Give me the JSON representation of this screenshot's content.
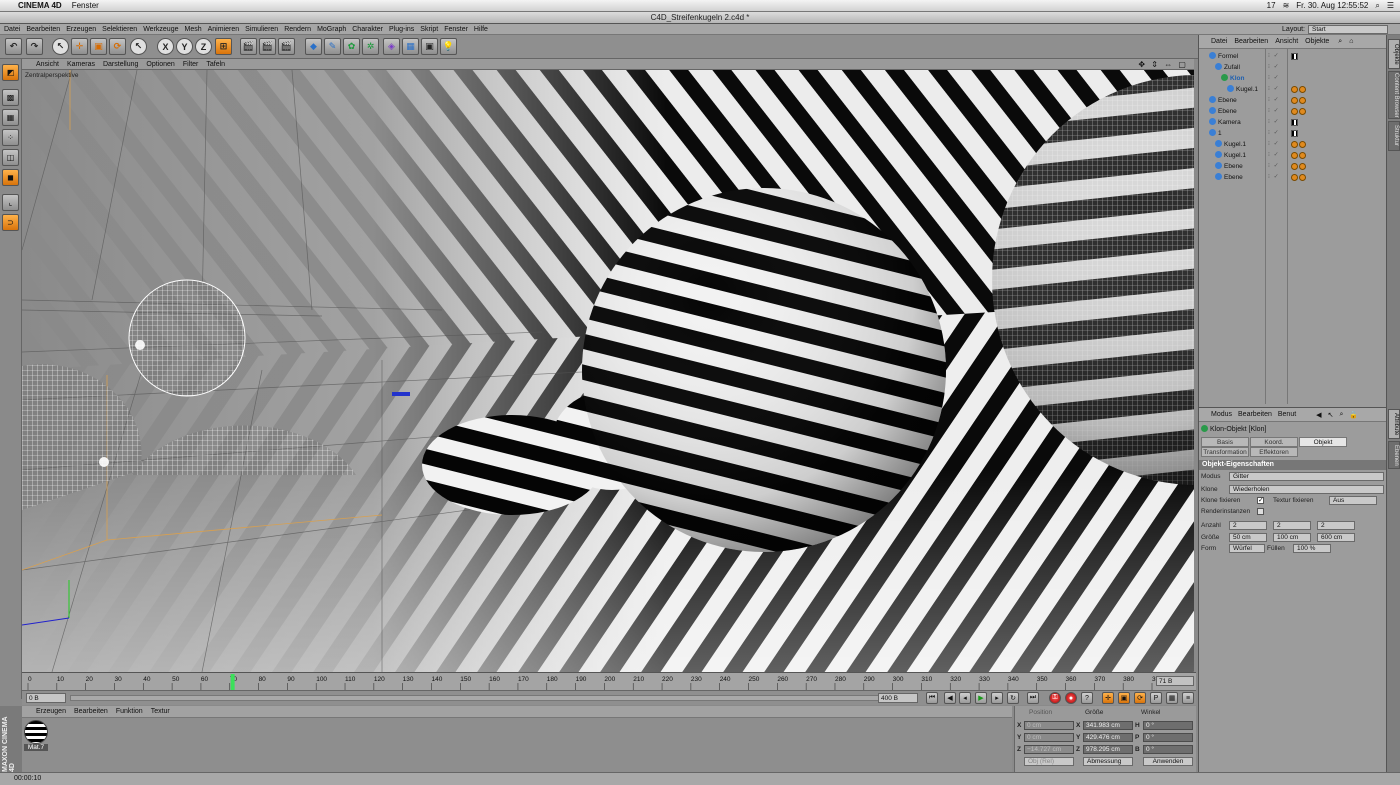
{
  "os": {
    "app": "CINEMA 4D",
    "menu": "Fenster",
    "status": [
      "17",
      "Fr. 30. Aug  12:55:52"
    ]
  },
  "window_title": "C4D_Streifenkugeln 2.c4d *",
  "menubar": {
    "items": [
      "Datei",
      "Bearbeiten",
      "Erzeugen",
      "Selektieren",
      "Werkzeuge",
      "Mesh",
      "Animieren",
      "Simulieren",
      "Rendern",
      "MoGraph",
      "Charakter",
      "Plug-ins",
      "Skript",
      "Fenster",
      "Hilfe"
    ],
    "layout_label": "Layout:",
    "layout_value": "Start"
  },
  "toolbar": {
    "axis_buttons": [
      "X",
      "Y",
      "Z"
    ]
  },
  "viewport": {
    "menu": [
      "Ansicht",
      "Kameras",
      "Darstellung",
      "Optionen",
      "Filter",
      "Tafeln"
    ],
    "label": "Zentralperspektive",
    "nav_icons": "✥ ⇕ ⇔ ▢"
  },
  "timeline": {
    "ticks": [
      "0",
      "10",
      "20",
      "30",
      "40",
      "50",
      "60",
      "70",
      "80",
      "90",
      "100",
      "110",
      "120",
      "130",
      "140",
      "150",
      "160",
      "170",
      "180",
      "190",
      "200",
      "210",
      "220",
      "230",
      "240",
      "250",
      "260",
      "270",
      "280",
      "290",
      "300",
      "310",
      "320",
      "330",
      "340",
      "350",
      "360",
      "370",
      "380",
      "390"
    ],
    "current": 71,
    "max": 390,
    "end_field": "71 B",
    "start_field": "0 B",
    "max_field": "400 B"
  },
  "materials": {
    "menu": [
      "Erzeugen",
      "Bearbeiten",
      "Funktion",
      "Textur"
    ],
    "items": [
      "Mat.7"
    ],
    "logo": "MAXON CINEMA 4D"
  },
  "coords": {
    "headers": [
      "Position",
      "Größe",
      "Winkel"
    ],
    "rows": [
      {
        "axis": "X",
        "pos": "0 cm",
        "size": "341.983 cm",
        "rot_axis": "H",
        "rot": "0 °"
      },
      {
        "axis": "Y",
        "pos": "0 cm",
        "size": "429.476 cm",
        "rot_axis": "P",
        "rot": "0 °"
      },
      {
        "axis": "Z",
        "pos": "−14.727 cm",
        "size": "978.295 cm",
        "rot_axis": "B",
        "rot": "0 °"
      }
    ],
    "mode1": "Obj (Rel)",
    "mode2": "Abmessung",
    "apply": "Anwenden"
  },
  "status_time": "00:00:10",
  "objects": {
    "menu": [
      "Datei",
      "Bearbeiten",
      "Ansicht",
      "Objekte"
    ],
    "rows": [
      {
        "name": "Formel",
        "indent": 1,
        "tags": [
          "chk"
        ]
      },
      {
        "name": "Zufall",
        "indent": 2,
        "tags": []
      },
      {
        "name": "Klon",
        "indent": 3,
        "tags": [],
        "selected": true
      },
      {
        "name": "Kugel.1",
        "indent": 4,
        "tags": [
          "o",
          "o"
        ]
      },
      {
        "name": "Ebene",
        "indent": 1,
        "tags": [
          "o",
          "o"
        ]
      },
      {
        "name": "Ebene",
        "indent": 1,
        "tags": [
          "o",
          "o"
        ]
      },
      {
        "name": "Kamera",
        "indent": 1,
        "tags": [
          "chk"
        ]
      },
      {
        "name": "1",
        "indent": 1,
        "tags": [
          "chk"
        ]
      },
      {
        "name": "Kugel.1",
        "indent": 2,
        "tags": [
          "o",
          "o"
        ]
      },
      {
        "name": "Kugel.1",
        "indent": 2,
        "tags": [
          "o",
          "o"
        ]
      },
      {
        "name": "Ebene",
        "indent": 2,
        "tags": [
          "o",
          "o"
        ]
      },
      {
        "name": "Ebene",
        "indent": 2,
        "tags": [
          "o",
          "o"
        ]
      }
    ]
  },
  "attributes": {
    "menu": [
      "Modus",
      "Bearbeiten",
      "Benut"
    ],
    "object_title": "Klon-Objekt [Klon]",
    "tabs": [
      "Basis",
      "Koord.",
      "Objekt"
    ],
    "tabs2": [
      "Transformation",
      "Effektoren"
    ],
    "active_tab": "Objekt",
    "section": "Objekt-Eigenschaften",
    "modus_label": "Modus",
    "modus_value": "Gitter",
    "klone_label": "Klone",
    "klone_value": "Wiederholen",
    "klone_fix_label": "Klone fixieren",
    "textur_fix_label": "Textur fixieren",
    "textur_fix_value": "Aus",
    "render_label": "Renderinstanzen",
    "anzahl_label": "Anzahl",
    "anzahl": [
      "2",
      "2",
      "2"
    ],
    "groesse_label": "Größe",
    "groesse": [
      "50 cm",
      "100 cm",
      "600 cm"
    ],
    "form_label": "Form",
    "form_value": "Würfel",
    "fuellen_label": "Füllen",
    "fuellen_value": "100 %"
  },
  "side_tabs": [
    "Objekte",
    "Content Browser",
    "Struktur",
    "Attribute",
    "Ebenen"
  ]
}
